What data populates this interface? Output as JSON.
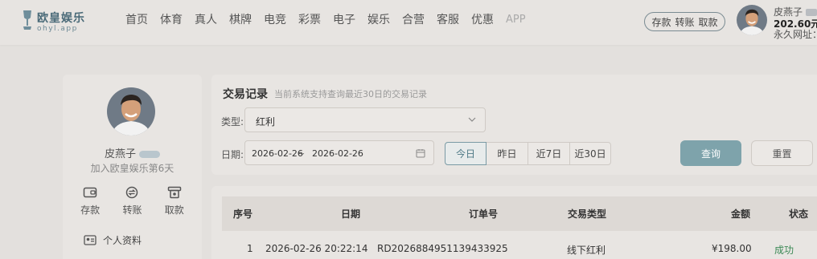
{
  "brand": {
    "title": "欧皇娱乐",
    "subtitle": "ohyl.app"
  },
  "nav": {
    "items": [
      "首页",
      "体育",
      "真人",
      "棋牌",
      "电竞",
      "彩票",
      "电子",
      "娱乐",
      "合营",
      "客服",
      "优惠",
      "APP"
    ]
  },
  "header_user": {
    "deposit": "存款",
    "transfer": "转账",
    "withdraw": "取款",
    "name": "皮燕子",
    "balance": "202.60元",
    "url_label": "永久网址："
  },
  "sidebar": {
    "name": "皮燕子",
    "days": "加入欧皇娱乐第6天",
    "actions": [
      "存款",
      "转账",
      "取款"
    ],
    "menu_profile": "个人资料"
  },
  "filter": {
    "title": "交易记录",
    "hint": "当前系统支持查询最近30日的交易记录",
    "type_label": "类型:",
    "type_value": "红利",
    "date_label": "日期:",
    "date_start": "2026-02-26",
    "date_sep": "~",
    "date_end": "2026-02-26",
    "quick": [
      "今日",
      "昨日",
      "近7日",
      "近30日"
    ],
    "search": "查询",
    "reset": "重置"
  },
  "table": {
    "headers": [
      "序号",
      "日期",
      "订单号",
      "交易类型",
      "金额",
      "状态"
    ],
    "rows": [
      [
        "1",
        "2026-02-26 20:22:14",
        "RD2026884951139433925",
        "线下红利",
        "¥198.00",
        "成功"
      ]
    ]
  },
  "colors": {
    "accent": "#7ea3ab",
    "success": "#3c8a56",
    "background": "#e3e0dd"
  }
}
